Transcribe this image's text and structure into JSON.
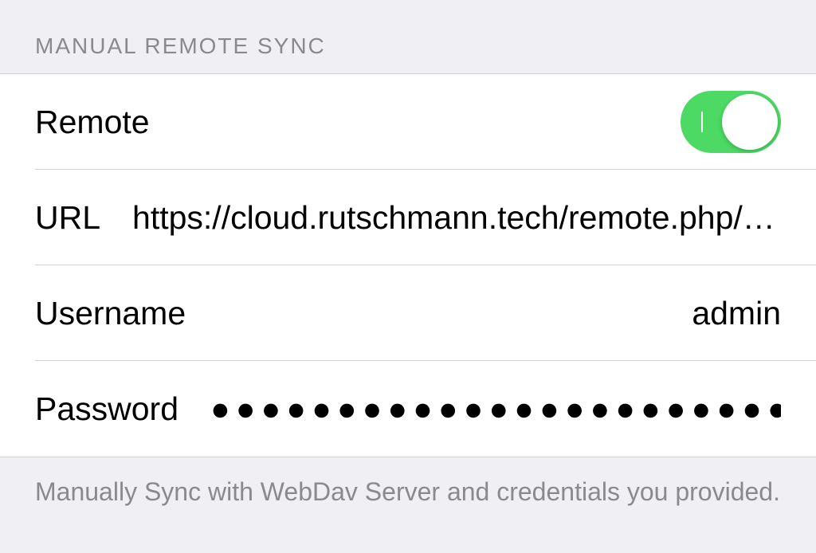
{
  "section": {
    "header": "MANUAL REMOTE SYNC",
    "footer": "Manually Sync with WebDav Server and credentials you provided."
  },
  "rows": {
    "remote": {
      "label": "Remote",
      "enabled": true
    },
    "url": {
      "label": "URL",
      "value": "https://cloud.rutschmann.tech/remote.php/d…"
    },
    "username": {
      "label": "Username",
      "value": "admin"
    },
    "password": {
      "label": "Password",
      "value": "●●●●●●●●●●●●●●●●●●●●●●●●●●●●"
    }
  }
}
